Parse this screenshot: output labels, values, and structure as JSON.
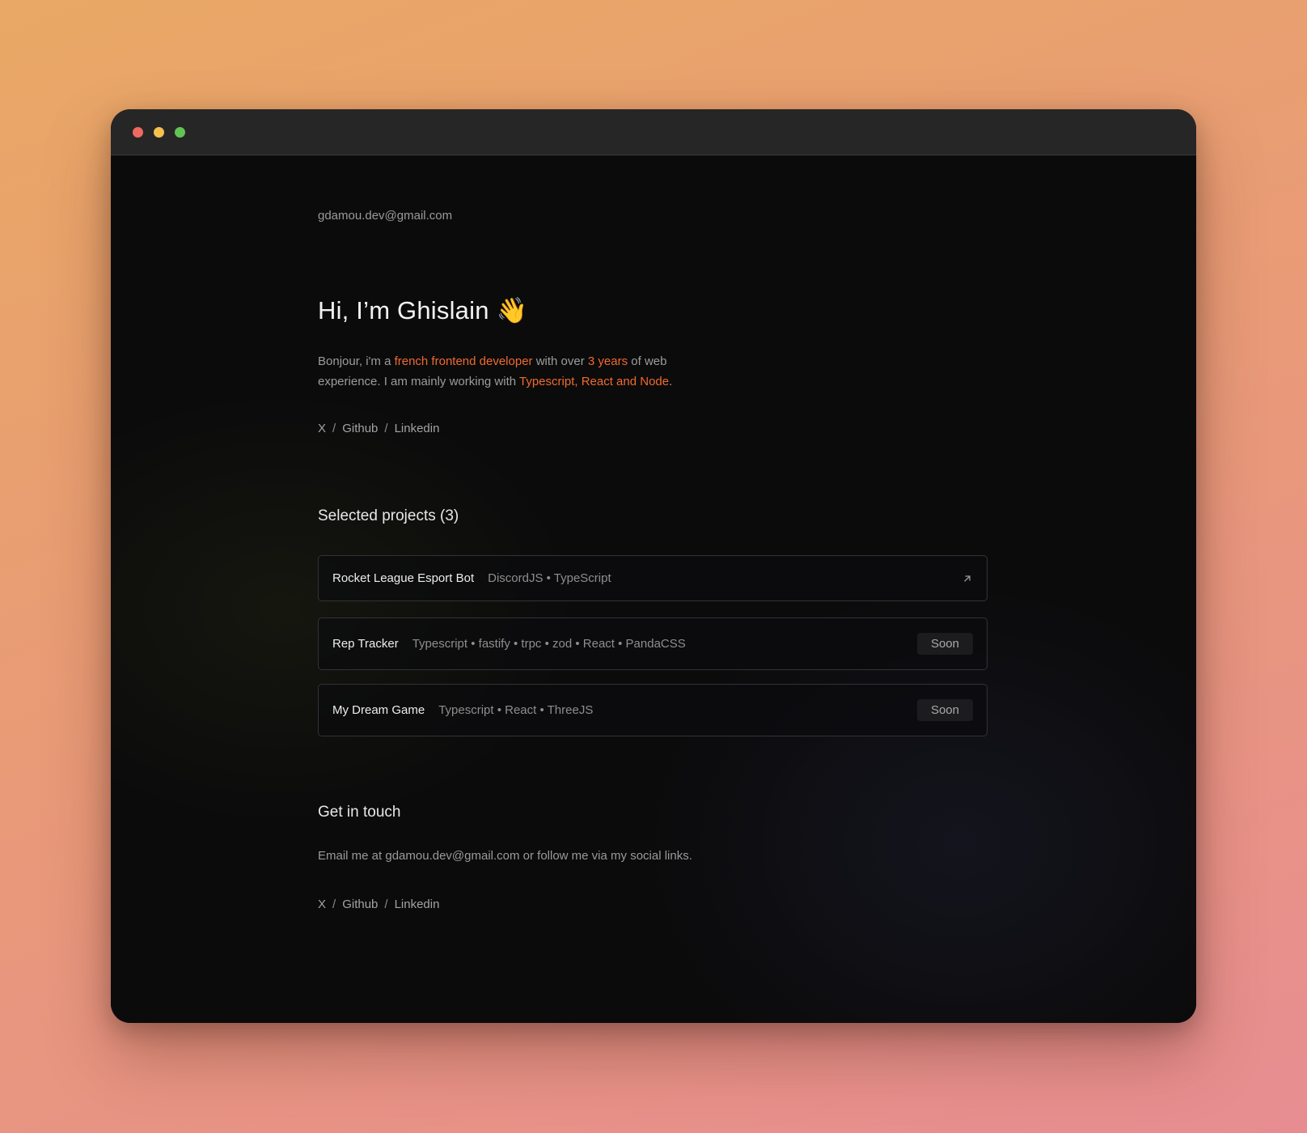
{
  "window": {
    "controls": [
      "close",
      "minimize",
      "maximize"
    ]
  },
  "header": {
    "email": "gdamou.dev@gmail.com"
  },
  "hero": {
    "title": "Hi, I’m Ghislain",
    "emoji": "👋",
    "intro": {
      "p1": "Bonjour, i'm a ",
      "h1": "french frontend developer",
      "p2": " with over ",
      "h2": "3 years",
      "p3": " of web experience. I am mainly working with ",
      "h3": "Typescript, React and Node",
      "p4": "."
    }
  },
  "social": {
    "separator": "/",
    "links": [
      "X",
      "Github",
      "Linkedin"
    ]
  },
  "projects": {
    "title": "Selected projects (3)",
    "items": [
      {
        "name": "Rocket League Esport Bot",
        "tags": "DiscordJS • TypeScript",
        "action_icon": "external-link-icon"
      },
      {
        "name": "Rep Tracker",
        "tags": "Typescript • fastify • trpc • zod • React • PandaCSS",
        "badge": "Soon"
      },
      {
        "name": "My Dream Game",
        "tags": "Typescript • React • ThreeJS",
        "badge": "Soon"
      }
    ]
  },
  "contact": {
    "title": "Get in touch",
    "text": "Email me at gdamou.dev@gmail.com or follow me via my social links."
  },
  "colors": {
    "accent": "#f06a2f",
    "background": "#0b0b0c",
    "titlebar": "#262626"
  }
}
